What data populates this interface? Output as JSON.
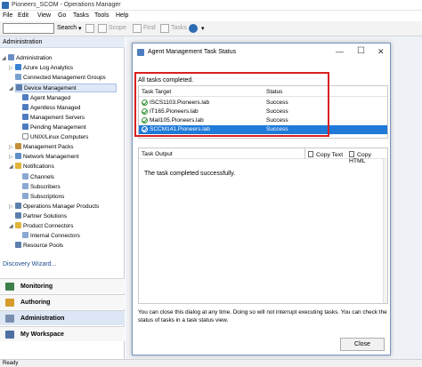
{
  "window": {
    "title": "Pioneers_SCOM - Operations Manager"
  },
  "menu": [
    "File",
    "Edit",
    "View",
    "Go",
    "Tasks",
    "Tools",
    "Help"
  ],
  "toolbar": {
    "search_label": "Search",
    "scope": "Scope",
    "find": "Find",
    "tasks": "Tasks"
  },
  "nav": {
    "header": "Administration",
    "items": [
      {
        "label": "Administration",
        "level": 0
      },
      {
        "label": "Azure Log Analytics",
        "level": 1
      },
      {
        "label": "Connected Management Groups",
        "level": 1
      },
      {
        "label": "Device Management",
        "level": 1
      },
      {
        "label": "Agent Managed",
        "level": 2
      },
      {
        "label": "Agentless Managed",
        "level": 2
      },
      {
        "label": "Management Servers",
        "level": 2
      },
      {
        "label": "Pending Management",
        "level": 2
      },
      {
        "label": "UNIX/Linux Computers",
        "level": 2
      },
      {
        "label": "Management Packs",
        "level": 1
      },
      {
        "label": "Network Management",
        "level": 1
      },
      {
        "label": "Notifications",
        "level": 1
      },
      {
        "label": "Channels",
        "level": 2
      },
      {
        "label": "Subscribers",
        "level": 2
      },
      {
        "label": "Subscriptions",
        "level": 2
      },
      {
        "label": "Operations Manager Products",
        "level": 1
      },
      {
        "label": "Partner Solutions",
        "level": 1
      },
      {
        "label": "Product Connectors",
        "level": 1
      },
      {
        "label": "Internal Connectors",
        "level": 2
      },
      {
        "label": "Resource Pools",
        "level": 1
      }
    ],
    "discovery": "Discovery Wizard...",
    "workspaces": [
      "Monitoring",
      "Authoring",
      "Administration",
      "My Workspace"
    ]
  },
  "status_bar": "Ready",
  "dialog": {
    "title": "Agent Management Task Status",
    "summary": "All tasks completed.",
    "col_target": "Task Target",
    "col_status": "Status",
    "rows": [
      {
        "target": "ISCS1103.Pioneers.lab",
        "status": "Success"
      },
      {
        "target": "IT165.Pioneers.lab",
        "status": "Success"
      },
      {
        "target": "Mail105.Pioneers.lab",
        "status": "Success"
      },
      {
        "target": "SCCM141.Pioneers.lab",
        "status": "Success"
      }
    ],
    "output_label": "Task Output",
    "copy_text": "Copy Text",
    "copy_html": "Copy HTML",
    "output": "The task completed successfully.",
    "info": "You can close this dialog at any time. Doing so will not interrupt executing tasks. You can check the status of tasks in a task status view.",
    "close": "Close"
  }
}
